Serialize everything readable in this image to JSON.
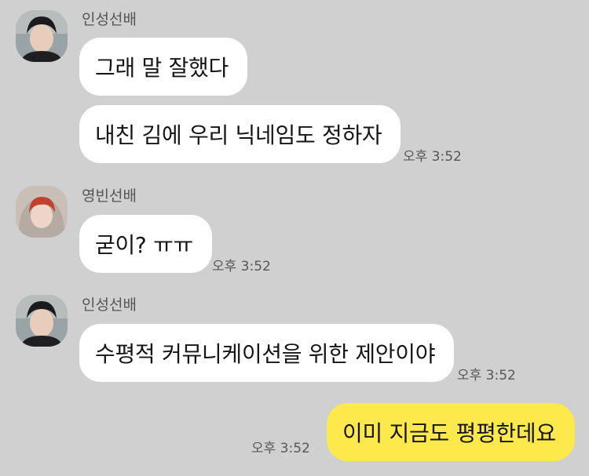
{
  "colors": {
    "background": "#d0d0d0",
    "incoming_bubble": "#ffffff",
    "outgoing_bubble": "#fde94b"
  },
  "messages": [
    {
      "sender": "인성선배",
      "avatar": "sender-photo-insung",
      "lines": [
        "그래 말 잘했다",
        "내친 김에 우리 닉네임도 정하자"
      ],
      "time": "오후 3:52"
    },
    {
      "sender": "영빈선배",
      "avatar": "sender-photo-youngbin",
      "lines": [
        "굳이? ㅠㅠ"
      ],
      "time": "오후 3:52"
    },
    {
      "sender": "인성선배",
      "avatar": "sender-photo-insung",
      "lines": [
        "수평적 커뮤니케이션을 위한 제안이야"
      ],
      "time": "오후 3:52"
    },
    {
      "sender": "",
      "outgoing": true,
      "lines": [
        "이미 지금도 평평한데요"
      ],
      "time": "오후 3:52"
    }
  ]
}
